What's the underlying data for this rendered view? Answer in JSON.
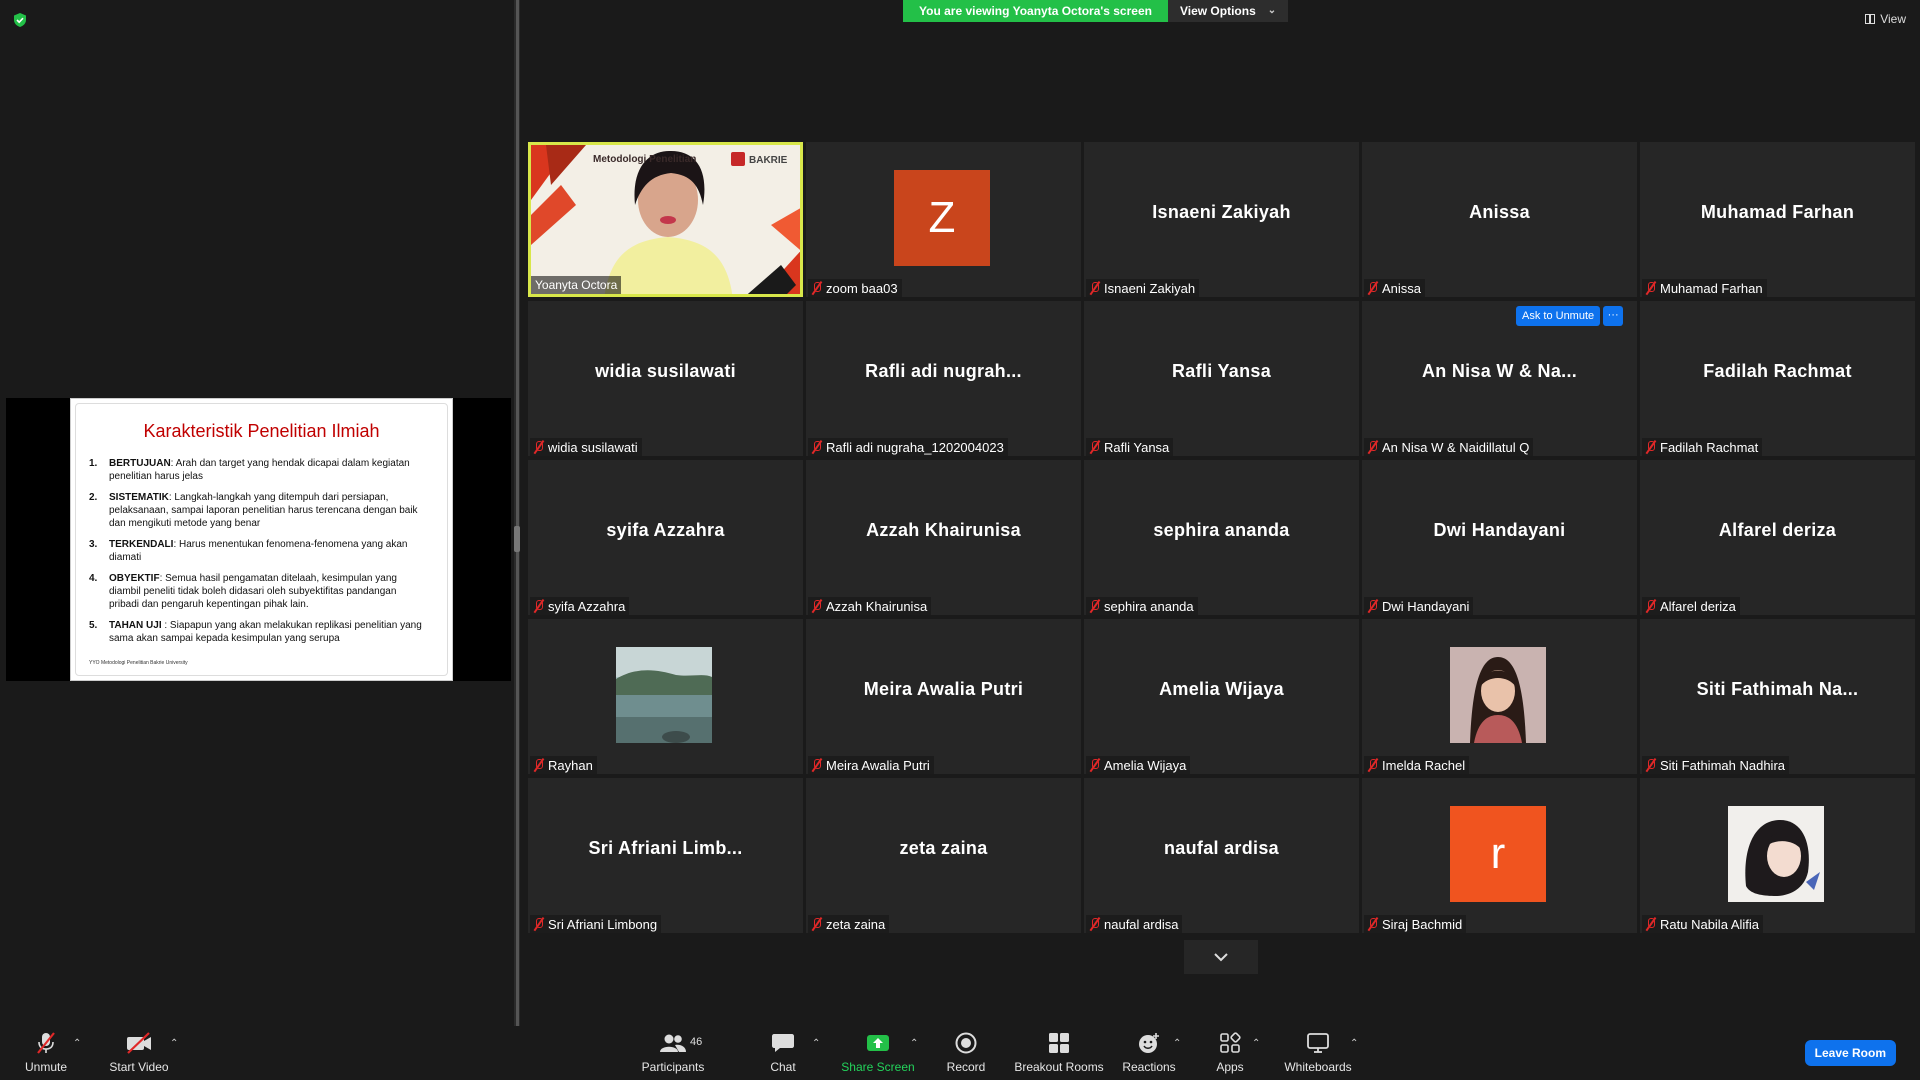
{
  "share_banner": {
    "viewing_text": "You are viewing Yoanyta Octora's screen",
    "view_options_label": "View Options"
  },
  "view_button_label": "View",
  "slide": {
    "title": "Karakteristik Penelitian Ilmiah",
    "items": [
      {
        "num": "1.",
        "term": "BERTUJUAN",
        "text": ": Arah dan target yang hendak dicapai dalam kegiatan penelitian harus jelas"
      },
      {
        "num": "2.",
        "term": "SISTEMATIK",
        "text": ": Langkah-langkah yang ditempuh dari persiapan, pelaksanaan, sampai laporan penelitian harus terencana dengan baik dan mengikuti metode yang benar"
      },
      {
        "num": "3.",
        "term": "TERKENDALI",
        "text": ": Harus menentukan fenomena-fenomena yang akan diamati"
      },
      {
        "num": "4.",
        "term": "OBYEKTIF",
        "text": ": Semua hasil pengamatan ditelaah, kesimpulan yang diambil peneliti tidak boleh didasari oleh subyektifitas pandangan pribadi dan pengaruh kepentingan pihak lain."
      },
      {
        "num": "5.",
        "term": "TAHAN UJI",
        "text": " : Siapapun yang akan melakukan replikasi penelitian yang sama akan sampai kepada kesimpulan yang serupa"
      }
    ],
    "footer": "YYO Metodologi Penelitian Bakrie University"
  },
  "speaker_tile": {
    "name": "Yoanyta Octora",
    "slide_heading": "Metodologi Penelitian",
    "logo_text": "BAKRIE"
  },
  "participants": [
    {
      "display": "",
      "label": "zoom baa03",
      "avatar": "Z",
      "avatar_color": "#c9451c"
    },
    {
      "display": "Isnaeni Zakiyah",
      "label": "Isnaeni Zakiyah"
    },
    {
      "display": "Anissa",
      "label": "Anissa"
    },
    {
      "display": "Muhamad Farhan",
      "label": "Muhamad Farhan"
    },
    {
      "display": "widia susilawati",
      "label": "widia susilawati"
    },
    {
      "display": "Rafli adi nugrah...",
      "label": "Rafli adi nugraha_1202004023"
    },
    {
      "display": "Rafli Yansa",
      "label": "Rafli Yansa"
    },
    {
      "display": "An Nisa W & Na...",
      "label": "An Nisa W & Naidillatul Q"
    },
    {
      "display": "Fadilah Rachmat",
      "label": "Fadilah Rachmat"
    },
    {
      "display": "syifa Azzahra",
      "label": "syifa Azzahra"
    },
    {
      "display": "Azzah Khairunisa",
      "label": "Azzah Khairunisa"
    },
    {
      "display": "sephira ananda",
      "label": "sephira ananda"
    },
    {
      "display": "Dwi Handayani",
      "label": "Dwi Handayani"
    },
    {
      "display": "Alfarel deriza",
      "label": "Alfarel deriza"
    },
    {
      "display": "",
      "label": "Rayhan",
      "photo": "landscape"
    },
    {
      "display": "Meira Awalia Putri",
      "label": "Meira Awalia Putri"
    },
    {
      "display": "Amelia Wijaya",
      "label": "Amelia Wijaya"
    },
    {
      "display": "",
      "label": "Imelda Rachel",
      "photo": "portrait"
    },
    {
      "display": "Siti Fathimah Na...",
      "label": "Siti Fathimah Nadhira"
    },
    {
      "display": "Sri Afriani Limb...",
      "label": "Sri Afriani Limbong"
    },
    {
      "display": "zeta zaina",
      "label": "zeta zaina"
    },
    {
      "display": "naufal ardisa",
      "label": "naufal ardisa"
    },
    {
      "display": "",
      "label": "Siraj Bachmid",
      "avatar": "r",
      "avatar_color": "#f0541f"
    },
    {
      "display": "",
      "label": "Ratu Nabila Alifia",
      "photo": "illustration"
    }
  ],
  "tile_actions": {
    "ask_to_unmute": "Ask to Unmute",
    "more": "···"
  },
  "toolbar": {
    "unmute": "Unmute",
    "start_video": "Start Video",
    "participants": "Participants",
    "participant_count": "46",
    "chat": "Chat",
    "share_screen": "Share Screen",
    "record": "Record",
    "breakout_rooms": "Breakout Rooms",
    "reactions": "Reactions",
    "apps": "Apps",
    "whiteboards": "Whiteboards",
    "leave_room": "Leave Room"
  },
  "colors": {
    "share_green": "#23c048",
    "zoom_blue": "#0e72ed",
    "speaker_border": "#d8e74a",
    "muted_red": "#e02828"
  }
}
